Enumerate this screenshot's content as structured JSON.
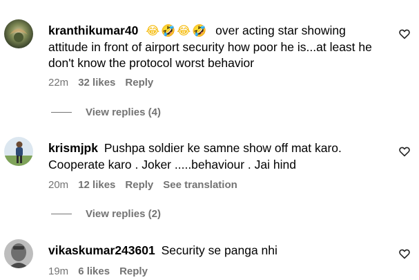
{
  "comments": [
    {
      "username": "kranthikumar40",
      "emojis": "😂🤣😂🤣",
      "text": "over acting star showing attitude in front of airport security how poor he is...at least he don't know the protocol worst behavior",
      "time": "22m",
      "likes": "32 likes",
      "reply_label": "Reply",
      "view_replies": "View replies (4)"
    },
    {
      "username": "krismjpk",
      "text": "Pushpa soldier ke samne show off mat karo. Cooperate karo . Joker .....behaviour . Jai hind",
      "time": "20m",
      "likes": "12 likes",
      "reply_label": "Reply",
      "translate_label": "See translation",
      "view_replies": "View replies (2)"
    },
    {
      "username": "vikaskumar243601",
      "text": "Security se panga nhi",
      "time": "19m",
      "likes": "6 likes",
      "reply_label": "Reply"
    }
  ],
  "icons": {
    "like": "heart-outline-icon"
  },
  "colors": {
    "text": "#000000",
    "meta": "#737373"
  }
}
